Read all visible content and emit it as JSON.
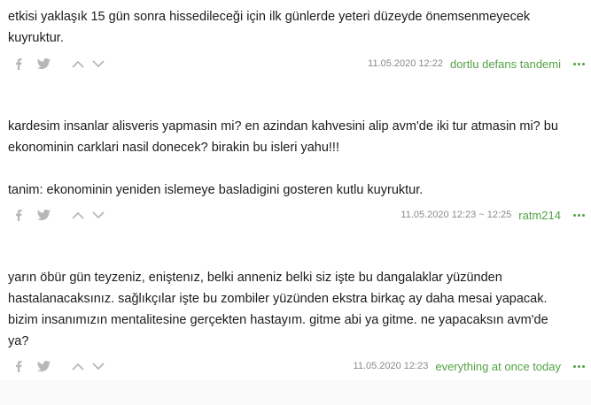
{
  "entries": [
    {
      "lines": [
        "etkisi yaklaşık 15 gün sonra hissedileceği için ilk günlerde yeteri düzeyde önemsenmeyecek",
        "kuyruktur."
      ],
      "date": "11.05.2020 12:22",
      "author": "dortlu defans tandemi"
    },
    {
      "lines": [
        "kardesim insanlar alisveris yapmasin mi? en azindan kahvesini alip avm'de iki tur atmasin mi? bu",
        "ekonominin carklari nasil donecek? birakin bu isleri yahu!!!"
      ],
      "lines2": [
        "tanim: ekonominin yeniden islemeye basladigini gosteren kutlu kuyruktur."
      ],
      "date": "11.05.2020 12:23 ~ 12:25",
      "author": "ratm214"
    },
    {
      "lines": [
        "yarın öbür gün teyzeniz, eniştenız, belki anneniz belki siz işte bu dangalaklar yüzünden",
        "hastalanacaksınız. sağlıkçılar işte bu zombiler yüzünden ekstra birkaç ay daha mesai yapacak.",
        "bizim insanımızın mentalitesine gerçekten hastayım. gitme abi ya gitme. ne yapacaksın avm'de",
        "ya?"
      ],
      "date": "11.05.2020 12:23",
      "author": "everything at once today"
    }
  ],
  "icons": {
    "share_facebook": "facebook-icon",
    "share_twitter": "twitter-icon",
    "vote_up": "chevron-up-icon",
    "vote_down": "chevron-down-icon",
    "more": "more-dots-icon"
  },
  "colors": {
    "author": "#53a245",
    "muted": "#b7b7b7",
    "date": "#8a8a8a",
    "text": "#1b1b1b"
  }
}
